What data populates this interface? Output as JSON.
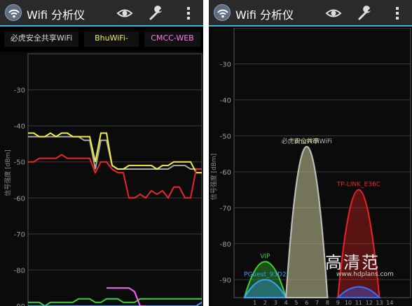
{
  "app": {
    "title": "Wifi 分析仪",
    "icons": [
      "wifi-app-icon",
      "eye-icon",
      "wrench-icon",
      "overflow-menu-icon"
    ]
  },
  "colors": {
    "accent": "#33b5e5",
    "action_bar": "#2a2a2a"
  },
  "left": {
    "ssid_filters": [
      {
        "label": "必虎安全共享WiFi",
        "color": "#d8d8d8"
      },
      {
        "label": "BhuWiFi-",
        "color": "#f0f060"
      },
      {
        "label": "CMCC-WEB",
        "color": "#ff7cf0"
      }
    ]
  },
  "right": {
    "watermark": {
      "big": "高清范",
      "small": "www.hdplans.com"
    }
  },
  "chart_data": [
    {
      "type": "line",
      "title": "",
      "xlabel": "",
      "ylabel": "信号强度 [dBm]",
      "ylim": [
        -90,
        -20
      ],
      "yticks": [
        -30,
        -40,
        -50,
        -60,
        -70,
        -80,
        -90
      ],
      "grid": true,
      "series": [
        {
          "name": "必虎安全共享WiFi",
          "color": "#a8a8a8",
          "values": [
            -43,
            -43,
            -43,
            -43,
            -43,
            -43,
            -43,
            -43,
            -43,
            -43,
            -44,
            -44,
            -52,
            -44,
            -44,
            -51,
            -52,
            -52,
            -52,
            -52,
            -52,
            -52,
            -52,
            -52,
            -52,
            -52,
            -51,
            -51,
            -51,
            -52,
            -52,
            -52
          ]
        },
        {
          "name": "BhuWiFi-",
          "color": "#f2ee40",
          "values": [
            -42,
            -42,
            -43,
            -43,
            -42,
            -43,
            -42,
            -42,
            -43,
            -43,
            -43,
            -43,
            -50,
            -42,
            -42,
            -51,
            -52,
            -52,
            -51,
            -51,
            -51,
            -51,
            -51,
            -52,
            -51,
            -51,
            -50,
            -50,
            -50,
            -50,
            -53,
            -53
          ]
        },
        {
          "name": "",
          "color": "#e8272b",
          "values": [
            -50,
            -50,
            -49,
            -49,
            -49,
            -49,
            -48,
            -49,
            -49,
            -49,
            -49,
            -49,
            -53,
            -50,
            -50,
            -52,
            -53,
            -53,
            -60,
            -60,
            -59,
            -60,
            -58,
            -59,
            -58,
            -60,
            -57,
            -57,
            -60,
            -60,
            -52,
            -52
          ]
        },
        {
          "name": "",
          "color": "#3bd33b",
          "values": [
            -89,
            -89,
            -89,
            -90,
            -89,
            -89,
            -89,
            -89,
            -89,
            -88,
            -88,
            -88,
            -89,
            -89,
            -88,
            -88,
            -88,
            -89,
            -89,
            -89,
            -88,
            -88,
            -88,
            -88,
            -88,
            -88,
            -88,
            -88,
            -88,
            -88,
            -88,
            -88
          ]
        },
        {
          "name": "",
          "color": "#3aa0ff",
          "values": [
            -90,
            -90,
            -90,
            -90,
            -90,
            -90,
            -90,
            -90,
            -90,
            -90,
            -90,
            -90,
            -90,
            -90,
            -90,
            -90,
            -90,
            -90,
            -90,
            -90,
            -90,
            -90,
            -90,
            -90,
            -90,
            -90,
            -90,
            -90,
            -90,
            -90,
            -90,
            -89
          ]
        },
        {
          "name": "",
          "color": "#ff66ff",
          "values": [
            null,
            null,
            null,
            null,
            null,
            null,
            null,
            null,
            null,
            null,
            null,
            null,
            null,
            null,
            -85,
            -85,
            -85,
            -85,
            -85,
            -86,
            -90,
            -90,
            null,
            null,
            null,
            null,
            null,
            null,
            null,
            null,
            null,
            null
          ]
        }
      ]
    },
    {
      "type": "area",
      "title": "",
      "xlabel": "",
      "ylabel": "信号强度 [dBm]",
      "ylim": [
        -95,
        -20
      ],
      "yticks": [
        -30,
        -40,
        -50,
        -60,
        -70,
        -80,
        -90
      ],
      "xticks": [
        1,
        2,
        3,
        4,
        5,
        6,
        7,
        8,
        9,
        10,
        11,
        12,
        13,
        14
      ],
      "grid": true,
      "series": [
        {
          "name": "VIP",
          "channel": 2,
          "peak": -85,
          "color": "#3bd33b"
        },
        {
          "name": "PGuest_93D2",
          "channel": 2,
          "peak": -90,
          "color": "#3aa0ff"
        },
        {
          "name": "BhuWiFi",
          "channel": 6,
          "peak": -53,
          "color": "#cfcf60"
        },
        {
          "name": "必虎安全共享WiFi",
          "channel": 6,
          "peak": -53,
          "color": "#bbbbbb"
        },
        {
          "name": "TP-LINK_E36C",
          "channel": 11,
          "peak": -65,
          "color": "#ee2222"
        },
        {
          "name": "",
          "channel": 11,
          "peak": -92,
          "color": "#3a6cff"
        }
      ]
    }
  ]
}
